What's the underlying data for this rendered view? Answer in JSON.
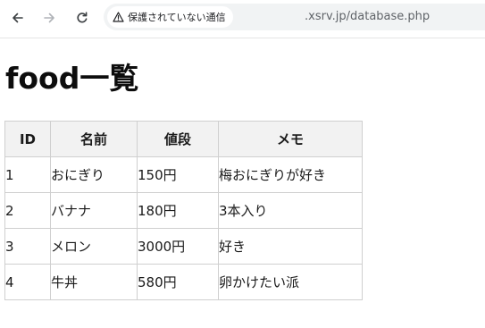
{
  "browser": {
    "security_label": "保護されていない通信",
    "url": ".xsrv.jp/database.php"
  },
  "page": {
    "title": "food一覧"
  },
  "table": {
    "headers": [
      "ID",
      "名前",
      "値段",
      "メモ"
    ],
    "rows": [
      [
        "1",
        "おにぎり",
        "150円",
        "梅おにぎりが好き"
      ],
      [
        "2",
        "バナナ",
        "180円",
        "3本入り"
      ],
      [
        "3",
        "メロン",
        "3000円",
        "好き"
      ],
      [
        "4",
        "牛丼",
        "580円",
        "卵かけたい派"
      ]
    ]
  }
}
